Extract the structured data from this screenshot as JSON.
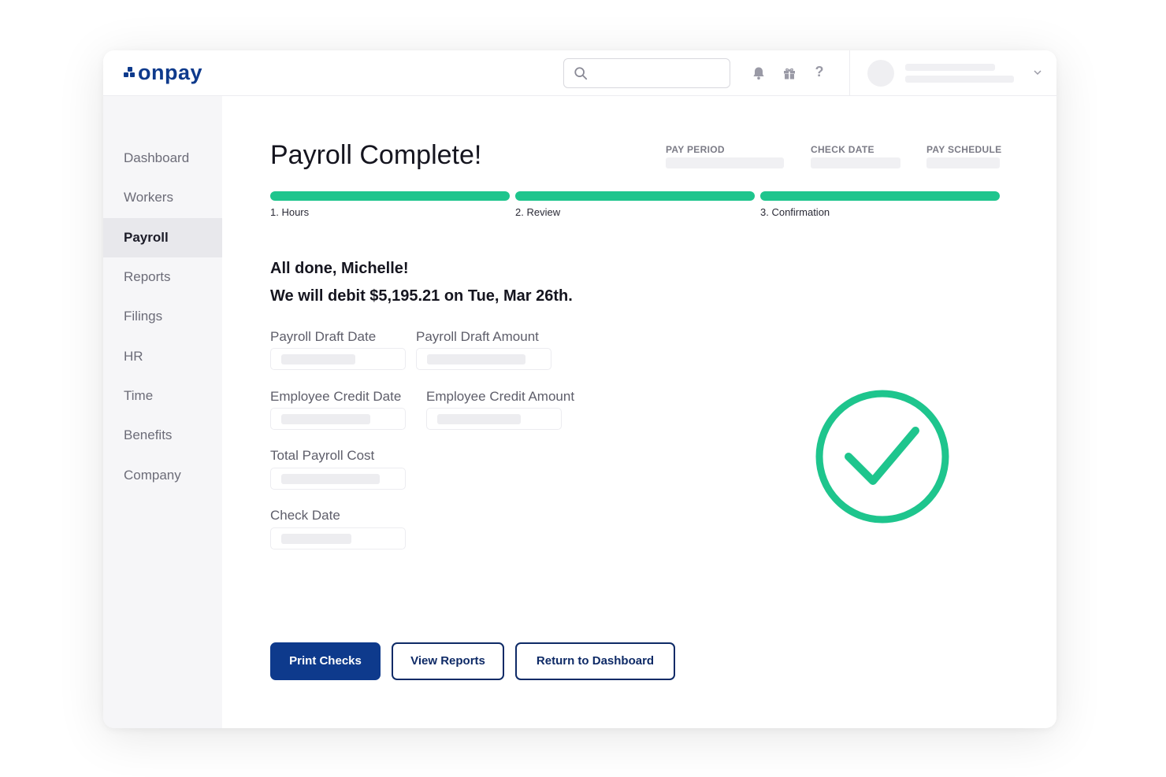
{
  "brand": {
    "name": "onpay",
    "color": "#0e3a8c"
  },
  "topbar": {
    "search": {
      "placeholder": "",
      "value": ""
    },
    "icons": [
      "search-icon",
      "bell-icon",
      "gift-icon",
      "help-icon",
      "chevron-down-icon"
    ],
    "help_glyph": "?"
  },
  "sidebar": {
    "items": [
      {
        "label": "Dashboard",
        "active": false
      },
      {
        "label": "Workers",
        "active": false
      },
      {
        "label": "Payroll",
        "active": true
      },
      {
        "label": "Reports",
        "active": false
      },
      {
        "label": "Filings",
        "active": false
      },
      {
        "label": "HR",
        "active": false
      },
      {
        "label": "Time",
        "active": false
      },
      {
        "label": "Benefits",
        "active": false
      },
      {
        "label": "Company",
        "active": false
      }
    ]
  },
  "main": {
    "title": "Payroll Complete!",
    "meta": {
      "pay_period_label": "PAY PERIOD",
      "check_date_label": "CHECK DATE",
      "pay_schedule_label": "PAY SCHEDULE"
    },
    "steps": [
      {
        "label": "1. Hours",
        "complete": true
      },
      {
        "label": "2. Review",
        "complete": true
      },
      {
        "label": "3. Confirmation",
        "complete": true
      }
    ],
    "message_line1": "All done, Michelle!",
    "message_line2": "We will debit $5,195.21 on Tue, Mar 26th.",
    "fields": {
      "payroll_draft_date": "Payroll Draft Date",
      "payroll_draft_amount": "Payroll Draft Amount",
      "employee_credit_date": "Employee Credit Date",
      "employee_credit_amount": "Employee Credit Amount",
      "total_payroll_cost": "Total Payroll Cost",
      "check_date": "Check Date"
    },
    "buttons": {
      "print_checks": "Print Checks",
      "view_reports": "View Reports",
      "return_to_dashboard": "Return to Dashboard"
    },
    "status_icon": "check-circle-icon"
  },
  "colors": {
    "accent_green": "#1ec58d",
    "primary_blue": "#0e3a8c",
    "outline_navy": "#0e2a66"
  }
}
